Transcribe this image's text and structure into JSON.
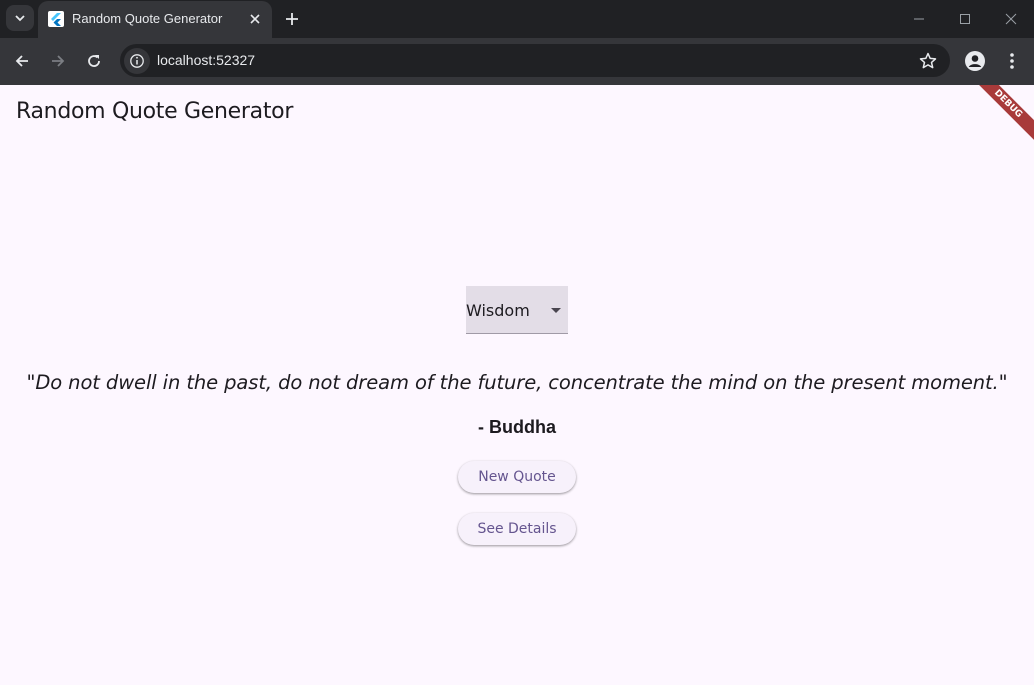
{
  "browser": {
    "tab_title": "Random Quote Generator",
    "url": "localhost:52327"
  },
  "app": {
    "title": "Random Quote Generator",
    "debug_banner": "DEBUG",
    "category_dropdown": {
      "selected": "Wisdom"
    },
    "quote": {
      "text": "\"Do not dwell in the past, do not dream of the future, concentrate the mind on the present moment.\"",
      "author": "- Buddha"
    },
    "buttons": {
      "new_quote": "New Quote",
      "see_details": "See Details"
    }
  },
  "colors": {
    "app_background": "#fdf7ff",
    "button_text": "#65558f",
    "debug_banner": "#a83a3a"
  }
}
